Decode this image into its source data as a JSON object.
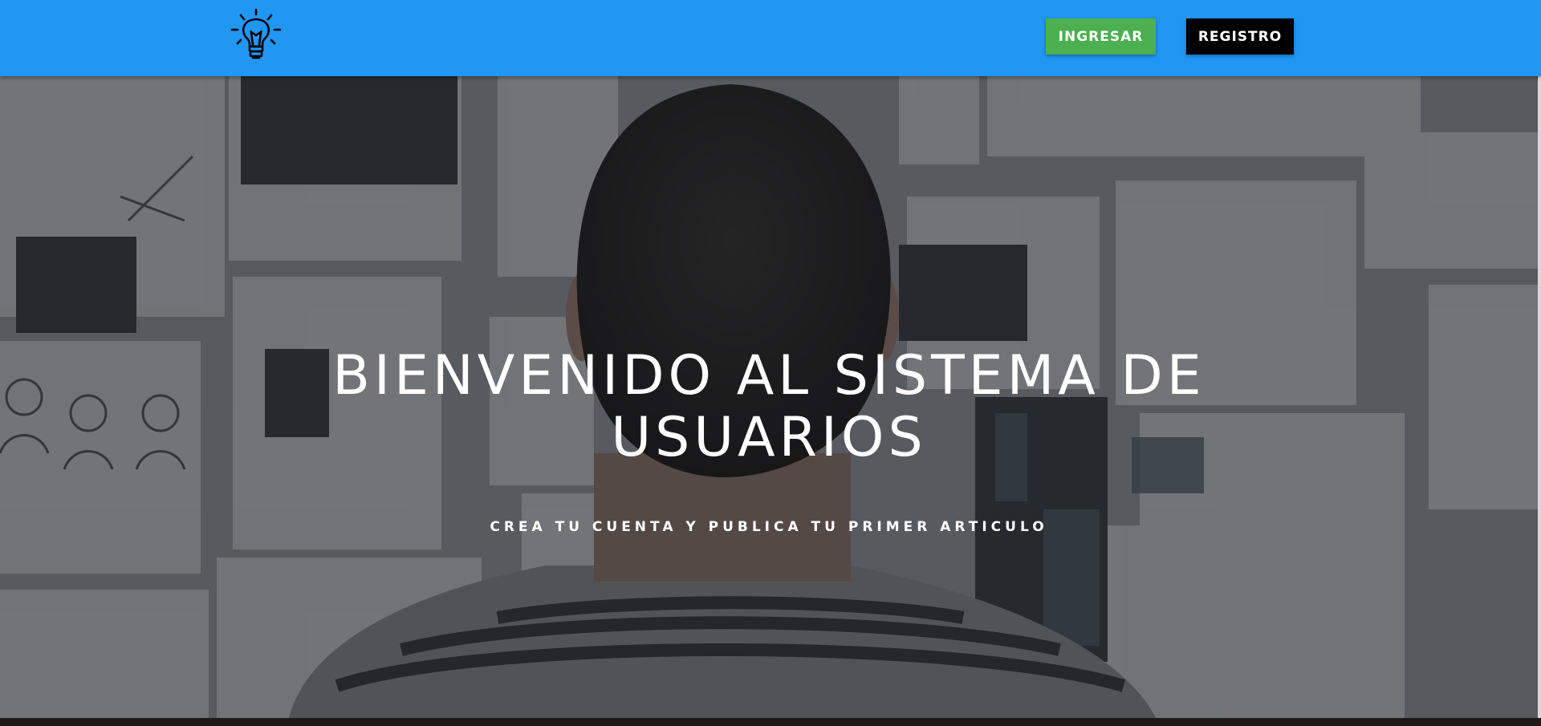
{
  "header": {
    "logo_icon": "lightbulb-icon",
    "login_label": "INGRESAR",
    "register_label": "REGISTRO"
  },
  "hero": {
    "title": "BIENVENIDO AL SISTEMA DE USUARIOS",
    "subtitle": "CREA TU CUENTA Y PUBLICA TU PRIMER ARTICULO",
    "background_image": "person-facing-wall-of-sketches"
  },
  "colors": {
    "navbar": "#2196f3",
    "login_button": "#4caf50",
    "register_button": "#000000",
    "text": "#ffffff"
  }
}
